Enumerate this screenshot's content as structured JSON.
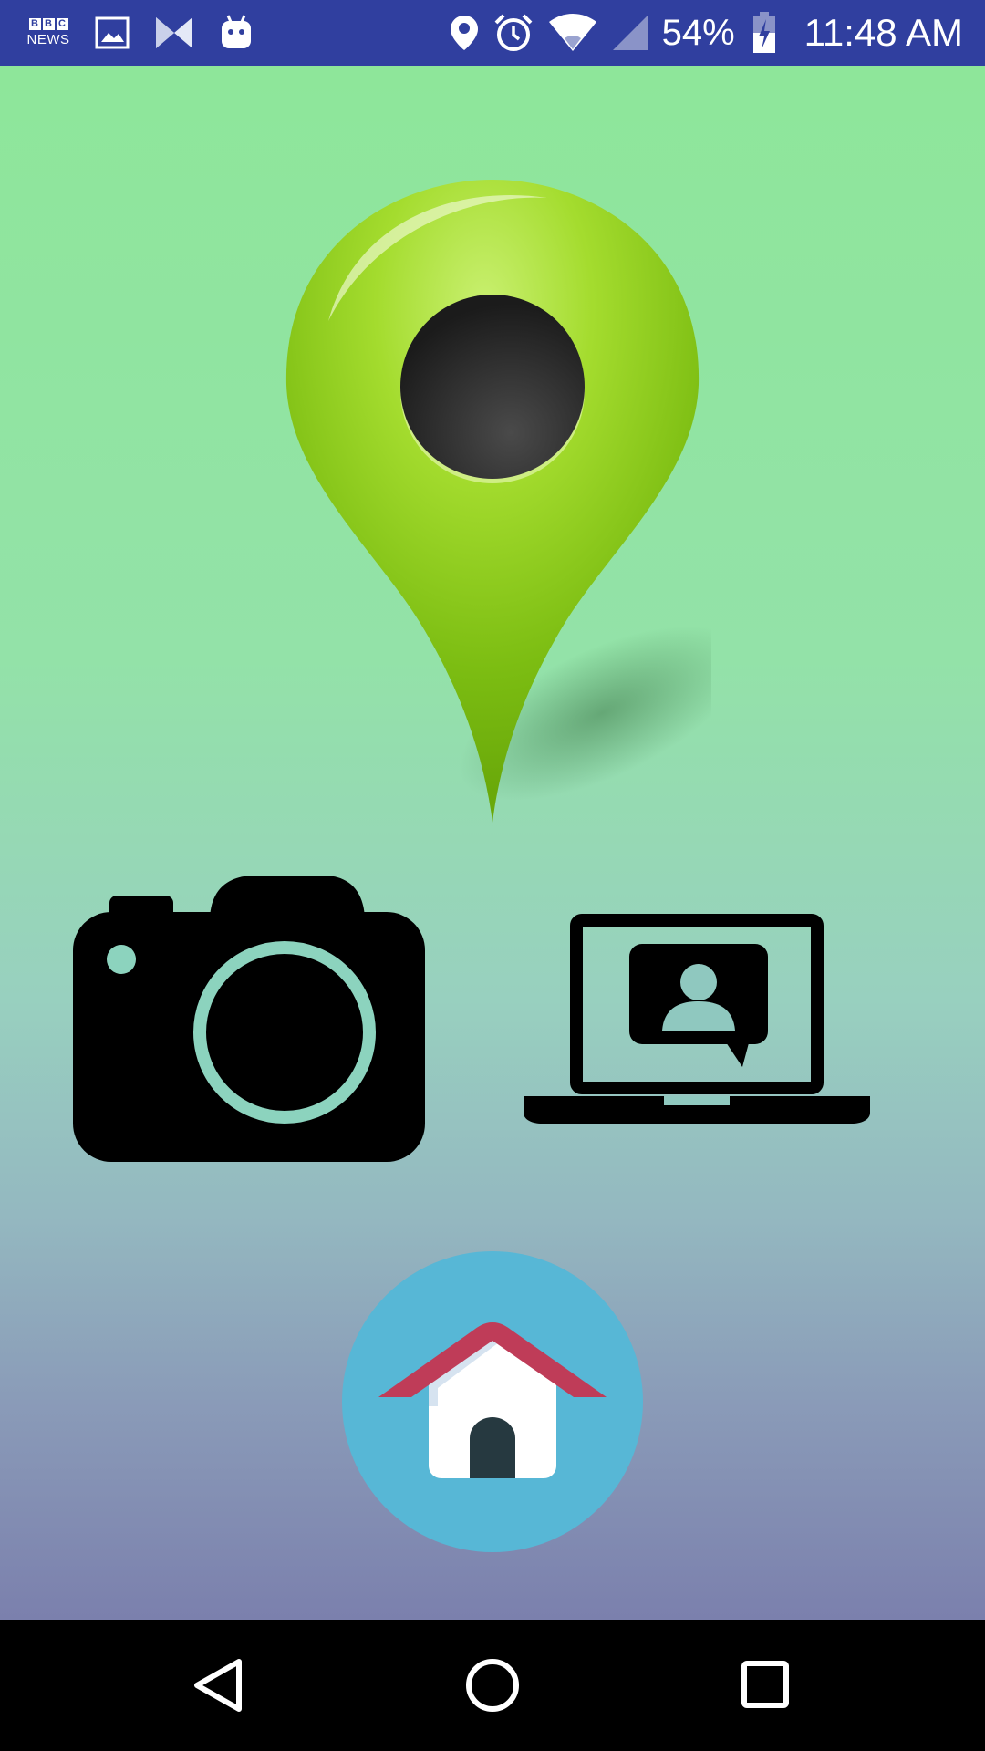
{
  "status_bar": {
    "bbc_logo_letters": [
      "B",
      "B",
      "C"
    ],
    "bbc_logo_sub": "NEWS",
    "icons": [
      "bbc-news-icon",
      "gallery-icon",
      "hourglass-app-icon",
      "android-icon",
      "location-icon",
      "alarm-icon",
      "wifi-icon",
      "cellular-signal-icon",
      "battery-charging-icon"
    ],
    "battery_percent": "54%",
    "time": "11:48 AM",
    "background_color": "#303f9f"
  },
  "main": {
    "pin_icon": "map-pin-icon",
    "camera_button_icon": "camera-icon",
    "laptop_button_icon": "laptop-chat-icon",
    "home_button_icon": "house-icon",
    "home_button_color": "#57b7d6",
    "pin_color": "#9ad32a"
  },
  "nav_bar": {
    "back": "back-icon",
    "home": "home-circle-icon",
    "recents": "recents-icon"
  }
}
